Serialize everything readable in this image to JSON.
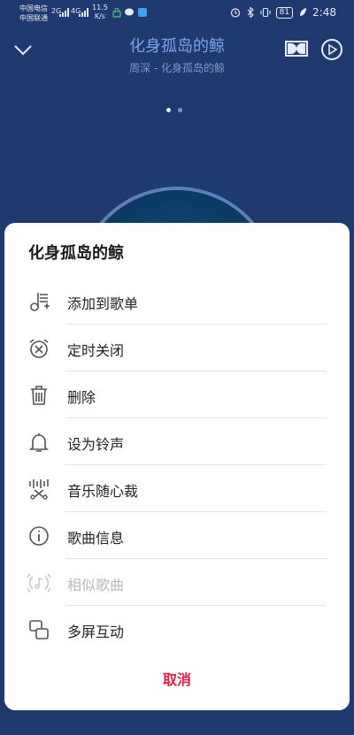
{
  "status_bar": {
    "carrier_1": "中国电信",
    "carrier_2": "中国联通",
    "signal_label_1": "2G",
    "signal_label_2": "4G",
    "net_speed_value": "11.5",
    "net_speed_unit": "K/s",
    "battery": "81",
    "time": "2:48"
  },
  "player": {
    "song_title": "化身孤岛的鲸",
    "artist_line": "周深 - 化身孤岛的鲸",
    "page_count": 2,
    "active_page": 1
  },
  "sheet": {
    "title": "化身孤岛的鲸",
    "items": [
      {
        "label": "添加到歌单",
        "icon": "add-to-playlist-icon",
        "enabled": true
      },
      {
        "label": "定时关闭",
        "icon": "alarm-off-icon",
        "enabled": true
      },
      {
        "label": "删除",
        "icon": "trash-icon",
        "enabled": true
      },
      {
        "label": "设为铃声",
        "icon": "bell-icon",
        "enabled": true
      },
      {
        "label": "音乐随心裁",
        "icon": "music-cut-icon",
        "enabled": true
      },
      {
        "label": "歌曲信息",
        "icon": "info-icon",
        "enabled": true
      },
      {
        "label": "相似歌曲",
        "icon": "similar-songs-icon",
        "enabled": false
      },
      {
        "label": "多屏互动",
        "icon": "multi-screen-icon",
        "enabled": true
      }
    ],
    "cancel_label": "取消"
  },
  "colors": {
    "background": "#1f3a6e",
    "title": "#7aa4e6",
    "cancel": "#e0203f"
  }
}
